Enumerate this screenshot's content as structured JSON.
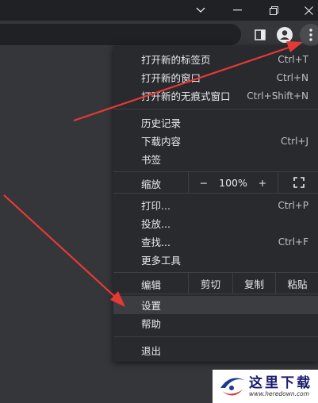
{
  "menu": {
    "new_tab": {
      "label": "打开新的标签页",
      "shortcut": "Ctrl+T"
    },
    "new_window": {
      "label": "打开新的窗口",
      "shortcut": "Ctrl+N"
    },
    "incognito": {
      "label": "打开新的无痕式窗口",
      "shortcut": "Ctrl+Shift+N"
    },
    "history": {
      "label": "历史记录"
    },
    "downloads": {
      "label": "下载内容",
      "shortcut": "Ctrl+J"
    },
    "bookmarks": {
      "label": "书签"
    },
    "zoom": {
      "label": "缩放",
      "minus": "−",
      "value": "100%",
      "plus": "+"
    },
    "print": {
      "label": "打印...",
      "shortcut": "Ctrl+P"
    },
    "cast": {
      "label": "投放..."
    },
    "find": {
      "label": "查找...",
      "shortcut": "Ctrl+F"
    },
    "more_tools": {
      "label": "更多工具"
    },
    "edit": {
      "label": "编辑",
      "cut": "剪切",
      "copy": "复制",
      "paste": "粘贴"
    },
    "settings": {
      "label": "设置"
    },
    "help": {
      "label": "帮助"
    },
    "exit": {
      "label": "退出"
    }
  },
  "watermark": {
    "text": "这里下载",
    "url": "www.heredown.com"
  },
  "colors": {
    "menu_bg": "#292a2d",
    "toolbar_bg": "#35363a",
    "arrow": "#e53935"
  }
}
